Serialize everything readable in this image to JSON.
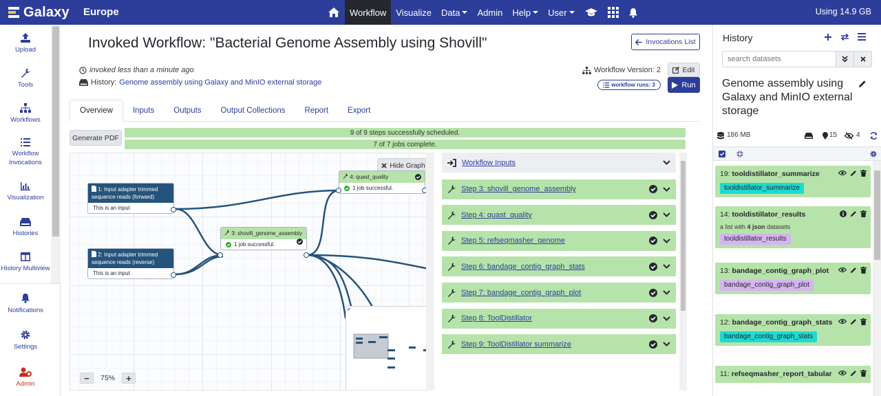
{
  "masthead": {
    "brand": "Galaxy",
    "subtitle": "Europe",
    "nav": [
      {
        "label": "",
        "icon": "home-icon"
      },
      {
        "label": "Workflow",
        "active": true
      },
      {
        "label": "Visualize"
      },
      {
        "label": "Data",
        "dropdown": true
      },
      {
        "label": "Admin"
      },
      {
        "label": "Help",
        "dropdown": true
      },
      {
        "label": "User",
        "dropdown": true
      },
      {
        "label": "",
        "icon": "graduation-cap-icon"
      },
      {
        "label": "",
        "icon": "grid-icon"
      },
      {
        "label": "",
        "icon": "bell-icon"
      }
    ],
    "quota": "Using 14.9 GB"
  },
  "activity_bar": [
    {
      "label": "Upload",
      "icon": "upload-icon"
    },
    {
      "label": "Tools",
      "icon": "wrench-icon"
    },
    {
      "label": "Workflows",
      "icon": "sitemap-icon"
    },
    {
      "label": "Workflow Invocations",
      "icon": "list-icon"
    },
    {
      "label": "Visualization",
      "icon": "chart-icon"
    },
    {
      "label": "Histories",
      "icon": "hdd-icon"
    },
    {
      "label": "History Multiview",
      "icon": "columns-icon"
    },
    {
      "label": "Notifications",
      "icon": "bell-icon"
    },
    {
      "label": "Settings",
      "icon": "gear-icon"
    },
    {
      "label": "Admin",
      "icon": "user-cog-icon"
    }
  ],
  "invocation": {
    "title": "Invoked Workflow: \"Bacterial Genome Assembly using Shovill\"",
    "invocations_list_label": "Invocations List",
    "invoked_time": "invoked less than a minute ago",
    "history_prefix": "History:",
    "history_name": "Genome assembly using Galaxy and MinIO external storage",
    "workflow_version": "Workflow Version: 2",
    "edit_label": "Edit",
    "run_label": "Run",
    "workflow_runs_label": "workflow runs: 3",
    "tabs": [
      "Overview",
      "Inputs",
      "Outputs",
      "Output Collections",
      "Report",
      "Export"
    ],
    "generate_pdf_label": "Generate PDF",
    "steps_scheduled": "9 of 9 steps successfully scheduled.",
    "jobs_complete": "7 of 7 jobs complete.",
    "steps_scheduled_fraction": 1.0,
    "jobs_complete_fraction": 1.0
  },
  "graph": {
    "hide_graph_label": "Hide Graph",
    "zoom_level": "75%",
    "nodes": [
      {
        "title": "1: Input adapter trimmed sequence reads (forward)",
        "body": "This is an input"
      },
      {
        "title": "2: Input adapter trimmed sequence reads (reverse)",
        "body": "This is an input"
      },
      {
        "title": "3: shovill_genome_assembly",
        "body": "1 job successful."
      },
      {
        "title": "4: quast_quality",
        "body": "1 job successful."
      }
    ]
  },
  "steps": [
    {
      "label": "Workflow Inputs",
      "type": "inputs"
    },
    {
      "label": "Step 3: shovill_genome_assembly"
    },
    {
      "label": "Step 4: quast_quality"
    },
    {
      "label": "Step 5: refseqmasher_genome"
    },
    {
      "label": "Step 6: bandage_contig_graph_stats"
    },
    {
      "label": "Step 7: bandage_contig_graph_plot"
    },
    {
      "label": "Step 8: ToolDistillator"
    },
    {
      "label": "Step 9: ToolDistillator summarize"
    }
  ],
  "history": {
    "title": "History",
    "search_placeholder": "search datasets",
    "name": "Genome assembly using Galaxy and MinIO external storage",
    "size": "186 MB",
    "shown_count": "15",
    "hidden_count": "4",
    "datasets": [
      {
        "hid": "19:",
        "name": "tooldistillator_summarize",
        "tag": "tooldistillator_summarize",
        "tag_color": "#1fd9d1",
        "info": false
      },
      {
        "hid": "14:",
        "name": "tooldistillator_results",
        "sub_prefix": "a list with ",
        "sub_count": "4",
        "sub_type": "json",
        "sub_suffix": " datasets",
        "tag": "tooldistillator_results",
        "tag_color": "#d6b4f0",
        "info": true
      },
      {
        "hid": "13:",
        "name": "bandage_contig_graph_plot",
        "tag": "bandage_contig_graph_plot",
        "tag_color": "#d6b4f0",
        "info": false
      },
      {
        "hid": "12:",
        "name": "bandage_contig_graph_stats",
        "tag": "bandage_contig_graph_stats",
        "tag_color": "#1fd9d1",
        "info": false
      },
      {
        "hid": "11:",
        "name": "refseqmasher_report_tabular",
        "tag": "",
        "tag_color": "",
        "info": false
      }
    ]
  },
  "colors": {
    "brand": "#2c3e9a",
    "success": "#b6e3a9",
    "input_node": "#25537b",
    "danger": "#c5311e"
  }
}
